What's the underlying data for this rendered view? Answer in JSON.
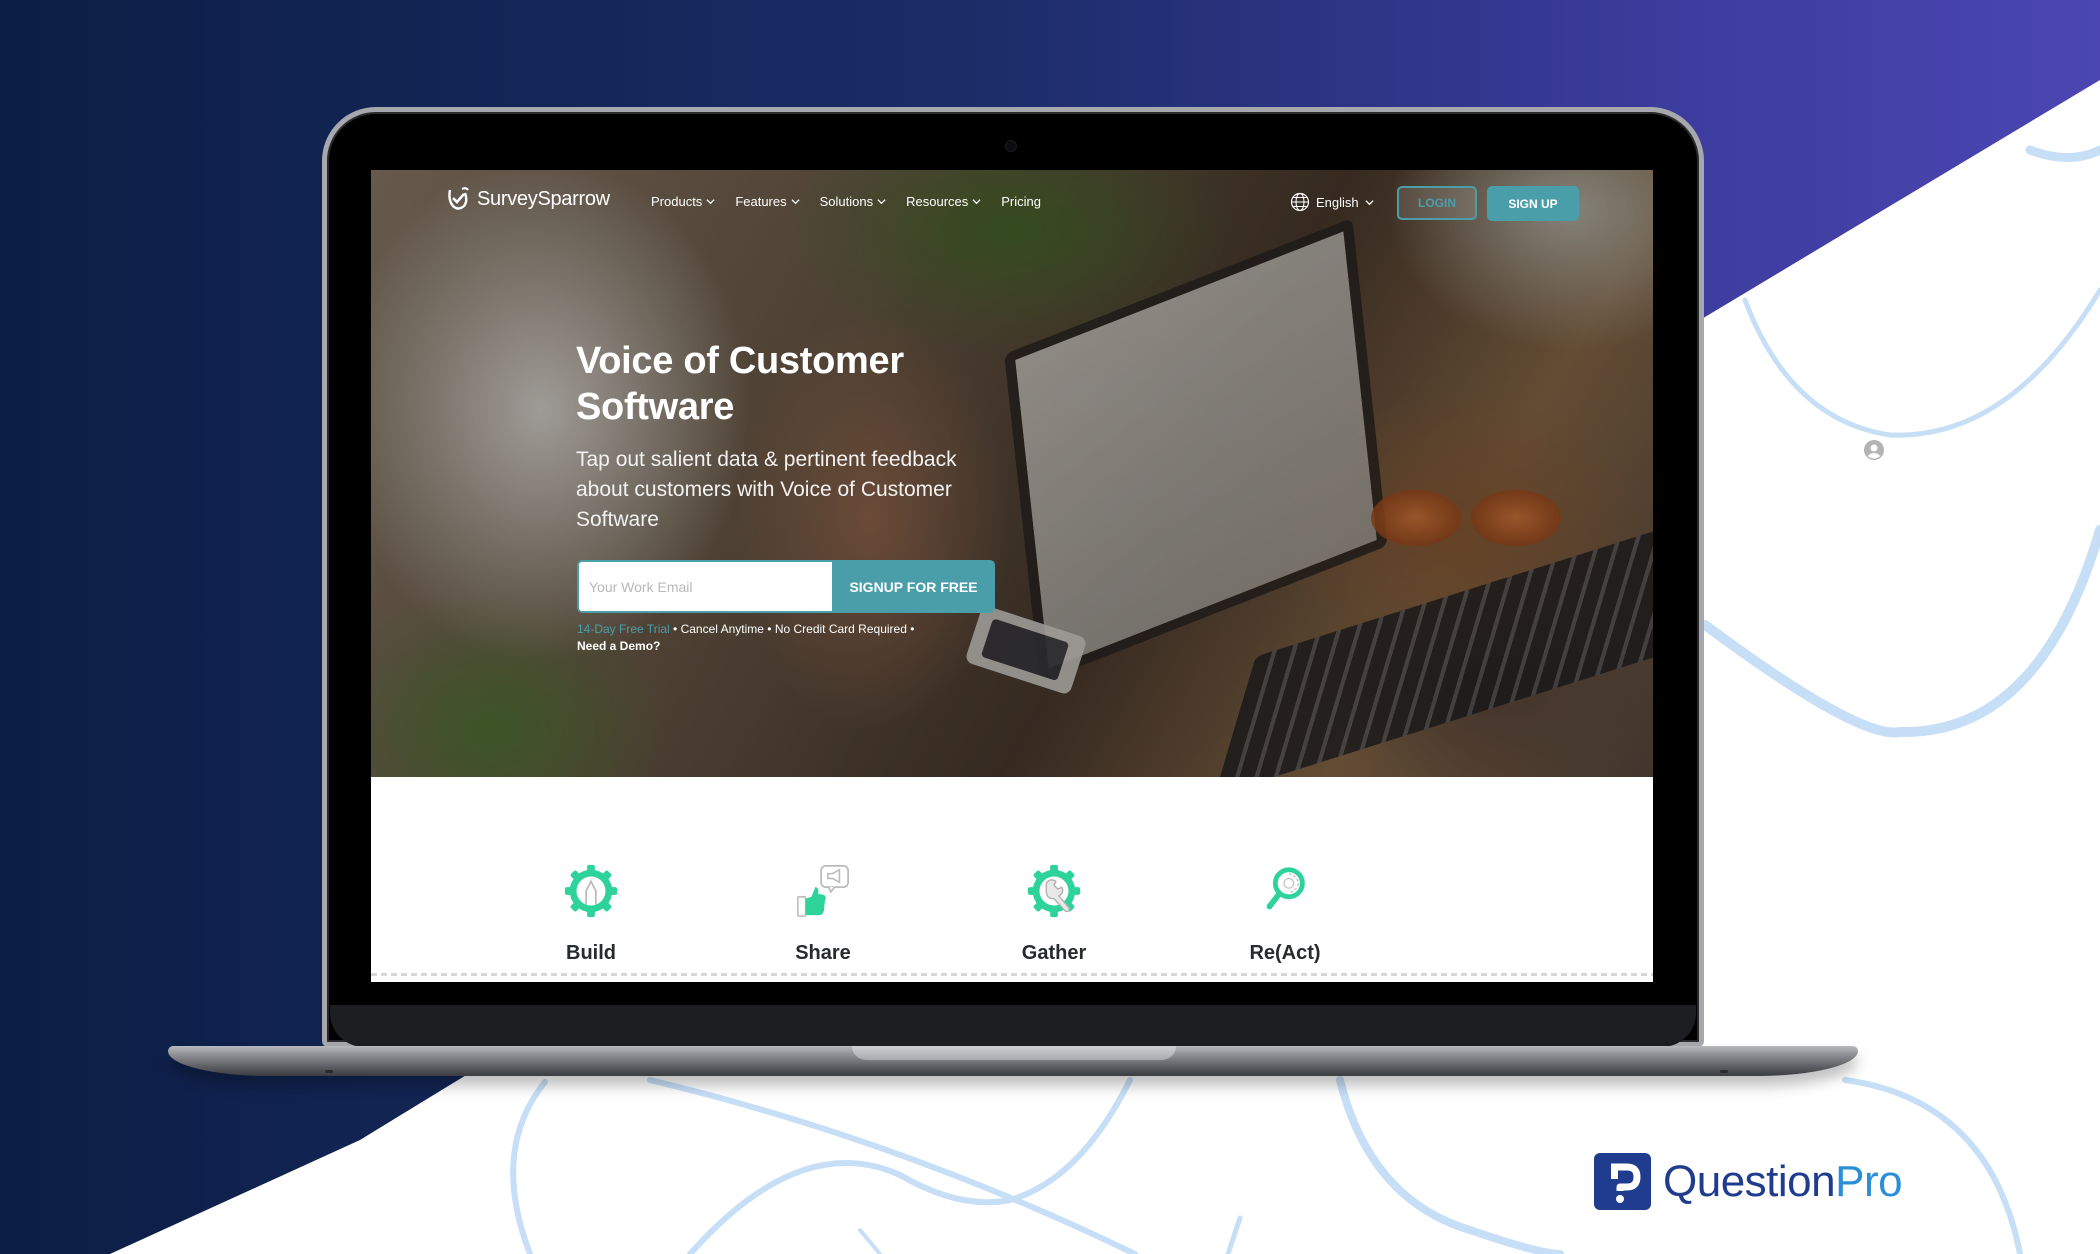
{
  "page": {
    "colors": {
      "bg_dark_navy": "#0d1f45",
      "bg_purple": "#4a44b0",
      "curve_light_blue": "#c6dff7",
      "accent_teal": "#4a9eaa",
      "feature_green": "#2ed39a",
      "questionpro_navy": "#1f3c8f",
      "questionpro_blue": "#2a8fd6"
    }
  },
  "website": {
    "brand": {
      "name": "SurveySparrow",
      "icon": "sparrow-check-logo-icon"
    },
    "nav": {
      "items": [
        {
          "label": "Products",
          "has_dropdown": true
        },
        {
          "label": "Features",
          "has_dropdown": true
        },
        {
          "label": "Solutions",
          "has_dropdown": true
        },
        {
          "label": "Resources",
          "has_dropdown": true
        },
        {
          "label": "Pricing",
          "has_dropdown": false
        }
      ],
      "language": {
        "label": "English",
        "icon": "globe-icon"
      },
      "login_label": "LOGIN",
      "signup_label": "SIGN UP"
    },
    "hero": {
      "title_line1": "Voice of Customer",
      "title_line2": "Software",
      "subtitle_line1": "Tap out salient data & pertinent feedback",
      "subtitle_line2": "about customers with Voice of Customer",
      "subtitle_line3": "Software",
      "email_placeholder": "Your Work Email",
      "email_value": "",
      "cta_label": "SIGNUP FOR FREE",
      "note_trial": "14-Day Free Trial",
      "note_rest": " • Cancel Anytime • No Credit Card Required •",
      "note_demo": "Need a Demo?"
    },
    "features": [
      {
        "label": "Build",
        "icon": "gear-pencil-icon"
      },
      {
        "label": "Share",
        "icon": "thumbs-up-megaphone-icon"
      },
      {
        "label": "Gather",
        "icon": "gear-wrench-icon"
      },
      {
        "label": "Re(Act)",
        "icon": "magnifier-gear-icon"
      }
    ]
  },
  "decorations": {
    "person_icon": "user-avatar-icon",
    "logo": {
      "part1": "Question",
      "part2": "Pro",
      "mark": "questionpro-p-icon"
    }
  }
}
